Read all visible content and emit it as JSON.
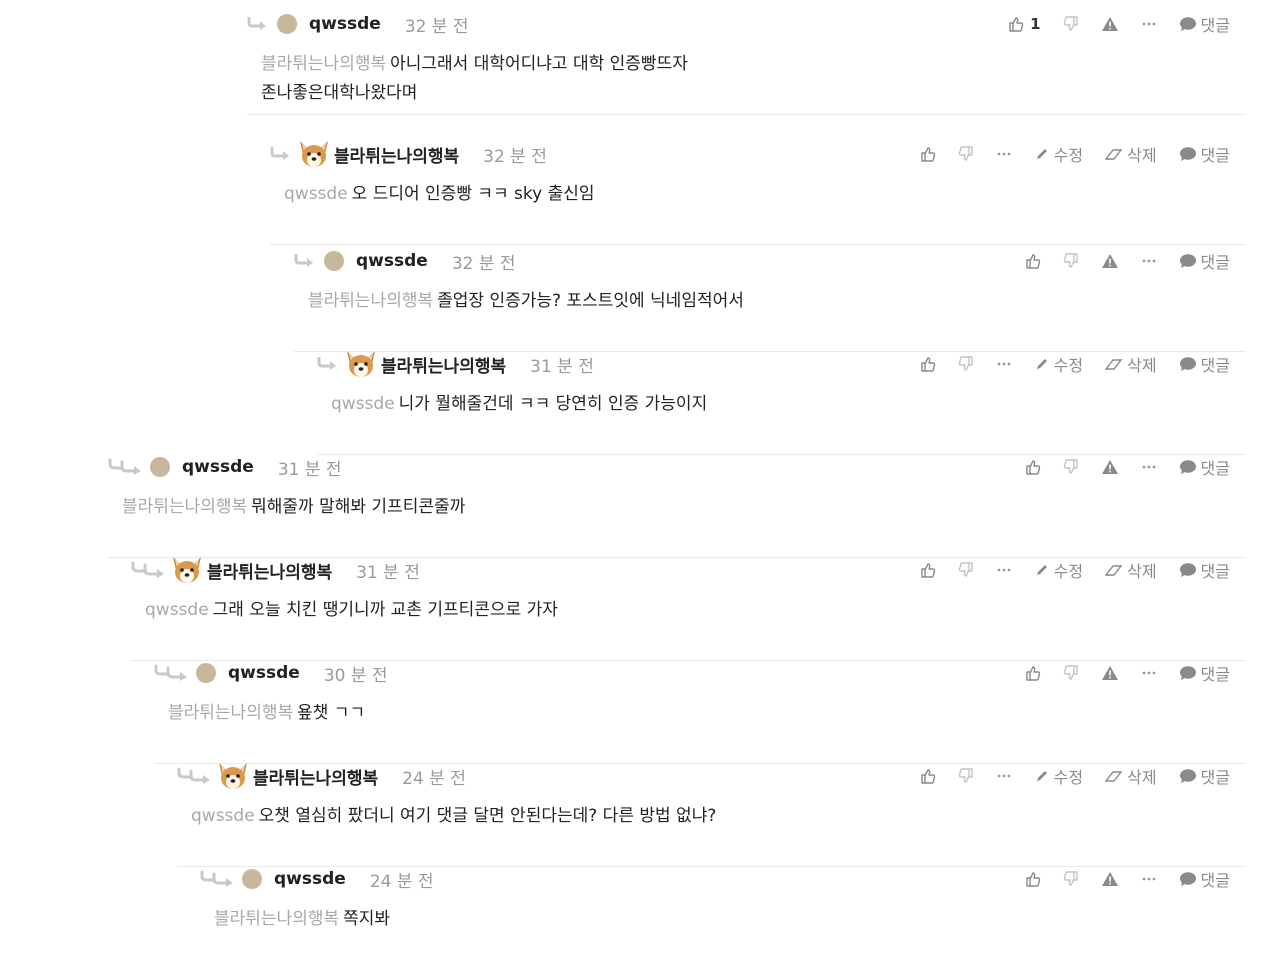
{
  "colors": {
    "mention": "#a8a8a8",
    "time": "#9a9a9a",
    "icon": "#8a8a8a",
    "divider": "#eaeaea",
    "avatar_dot": "#c8b89b"
  },
  "actions": {
    "edit_label": "수정",
    "delete_label": "삭제",
    "reply_label": "댓글"
  },
  "comments": [
    {
      "author": "qwssde",
      "time": "32 분 전",
      "mention": "블라튀는나의행복",
      "text": "아니그래서 대학어디냐고 대학 인증빵뜨자\n존나좋은대학나왔다며",
      "likes": "1",
      "avatar": "dot"
    },
    {
      "author": "블라튀는나의행복",
      "time": "32 분 전",
      "mention": "qwssde",
      "text": "오 드디어 인증빵 ㅋㅋ sky 출신임",
      "avatar": "dog"
    },
    {
      "author": "qwssde",
      "time": "32 분 전",
      "mention": "블라튀는나의행복",
      "text": "졸업장 인증가능? 포스트잇에 닉네임적어서",
      "avatar": "dot"
    },
    {
      "author": "블라튀는나의행복",
      "time": "31 분 전",
      "mention": "qwssde",
      "text": "니가 뭘해줄건데 ㅋㅋ 당연히 인증 가능이지",
      "avatar": "dog"
    },
    {
      "author": "qwssde",
      "time": "31 분 전",
      "mention": "블라튀는나의행복",
      "text": "뭐해줄까 말해봐 기프티콘줄까",
      "avatar": "dot"
    },
    {
      "author": "블라튀는나의행복",
      "time": "31 분 전",
      "mention": "qwssde",
      "text": "그래 오늘 치킨 땡기니까 교촌 기프티콘으로 가자",
      "avatar": "dog"
    },
    {
      "author": "qwssde",
      "time": "30 분 전",
      "mention": "블라튀는나의행복",
      "text": "욮챗 ㄱㄱ",
      "avatar": "dot"
    },
    {
      "author": "블라튀는나의행복",
      "time": "24 분 전",
      "mention": "qwssde",
      "text": "오챗 열심히 팠더니 여기 댓글 달면 안된다는데? 다른 방법 없냐?",
      "avatar": "dog"
    },
    {
      "author": "qwssde",
      "time": "24 분 전",
      "mention": "블라튀는나의행복",
      "text": "쪽지봐",
      "avatar": "dot"
    }
  ]
}
